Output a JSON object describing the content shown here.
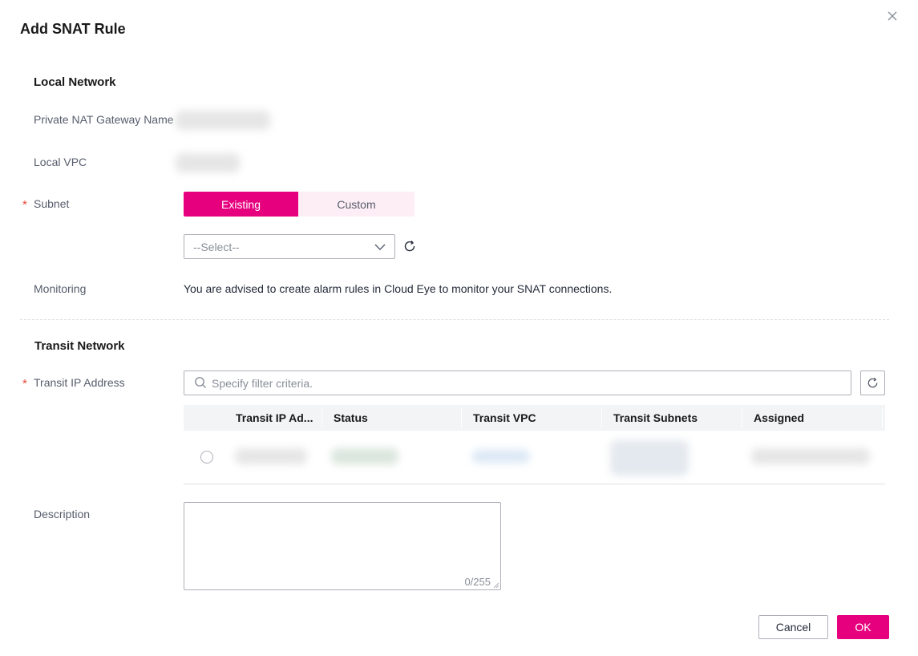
{
  "dialog": {
    "title": "Add SNAT Rule"
  },
  "local_network": {
    "title": "Local Network",
    "gateway_name_label": "Private NAT Gateway Name",
    "local_vpc_label": "Local VPC",
    "subnet_label": "Subnet",
    "subnet_options": [
      "Existing",
      "Custom"
    ],
    "subnet_selected": "Existing",
    "subnet_select_value": "--Select--",
    "monitoring_label": "Monitoring",
    "monitoring_text": "You are advised to create alarm rules in Cloud Eye to monitor your SNAT connections."
  },
  "transit_network": {
    "title": "Transit Network",
    "transit_ip_label": "Transit IP Address",
    "search_placeholder": "Specify filter criteria.",
    "columns": [
      "Transit IP Ad...",
      "Status",
      "Transit VPC",
      "Transit Subnets",
      "Assigned"
    ]
  },
  "description": {
    "label": "Description",
    "counter": "0/255"
  },
  "footer": {
    "cancel_label": "Cancel",
    "ok_label": "OK"
  },
  "colors": {
    "accent": "#e6007e",
    "accent_light": "#fdeef6",
    "required": "#e8483c"
  },
  "icons": [
    "close-icon",
    "chevron-down-icon",
    "refresh-icon",
    "search-icon"
  ]
}
